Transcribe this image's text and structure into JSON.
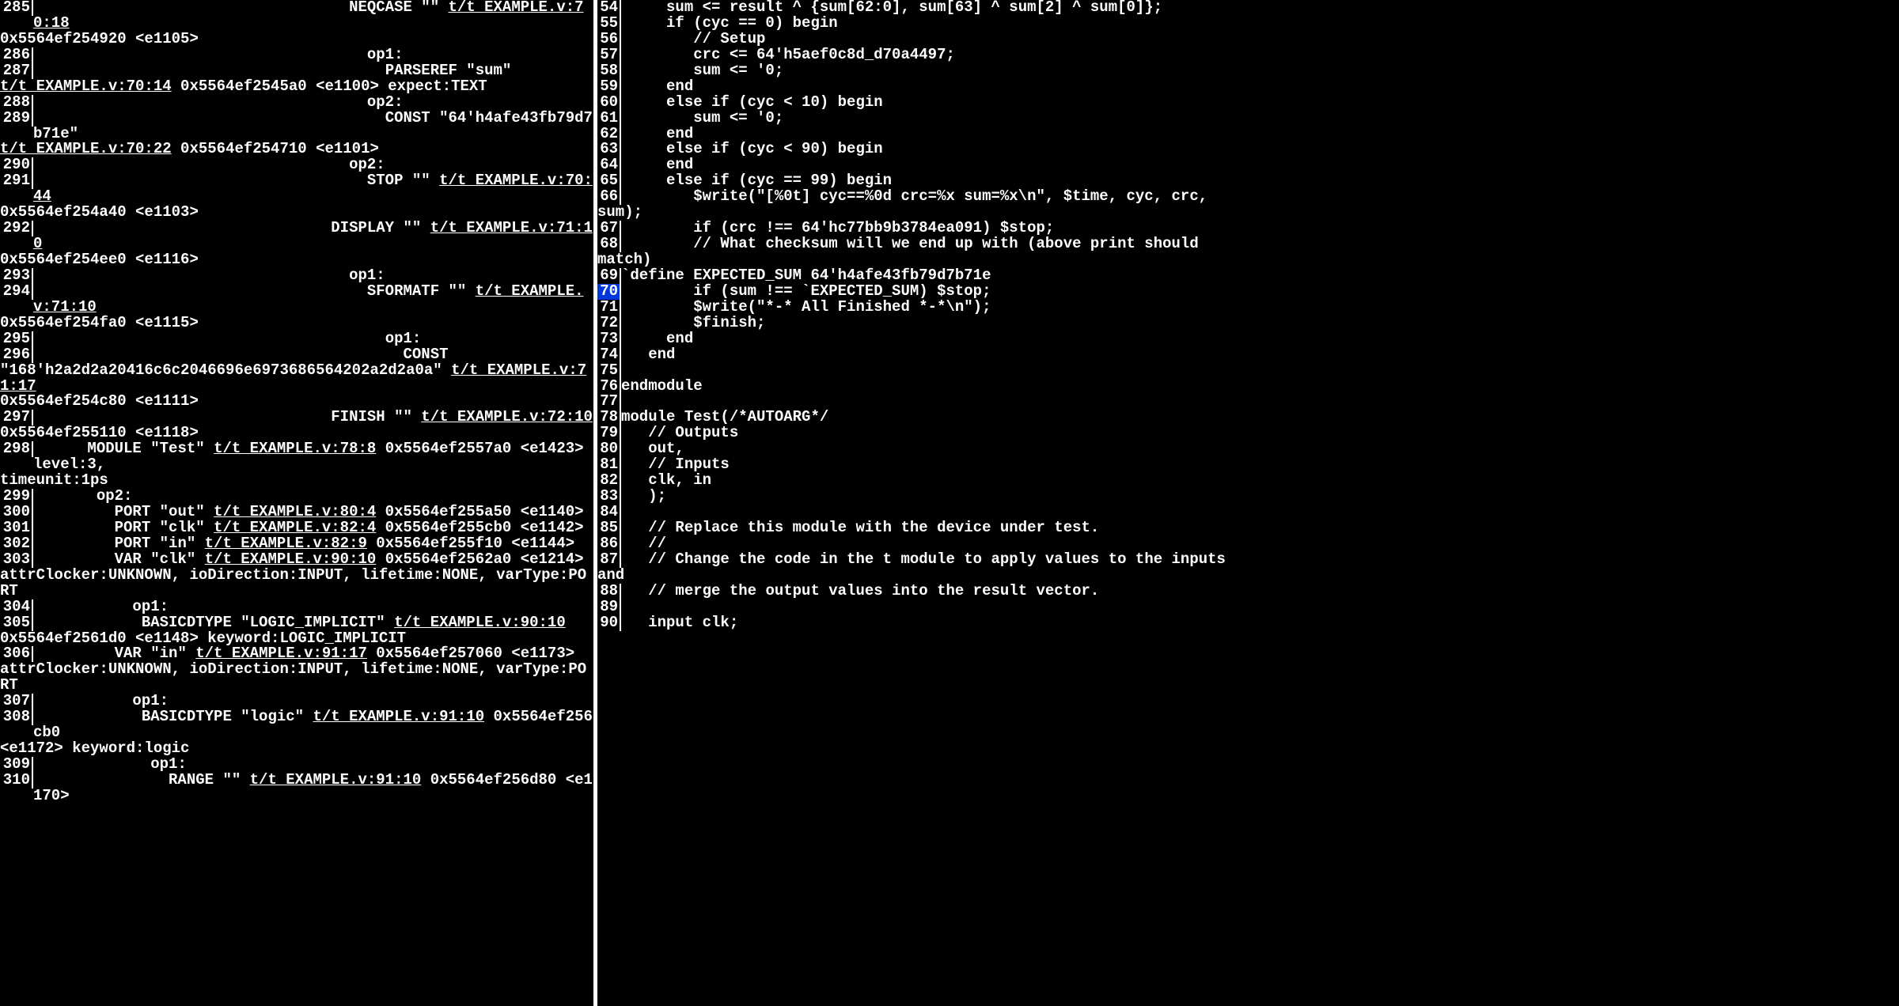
{
  "left": [
    {
      "n": "285",
      "segs": [
        {
          "t": "                                   NEQCASE \"\" "
        },
        {
          "t": "t/t_EXAMPLE.v:70:18",
          "u": true
        }
      ]
    },
    {
      "n": "",
      "segs": [
        {
          "t": "0x5564ef254920 <e1105>"
        }
      ]
    },
    {
      "n": "286",
      "segs": [
        {
          "t": "                                     op1:"
        }
      ]
    },
    {
      "n": "287",
      "segs": [
        {
          "t": "                                       PARSEREF \"sum\""
        }
      ]
    },
    {
      "n": "",
      "segs": [
        {
          "t": "t/t_EXAMPLE.v:70:14",
          "u": true
        },
        {
          "t": " 0x5564ef2545a0 <e1100> expect:TEXT"
        }
      ]
    },
    {
      "n": "288",
      "segs": [
        {
          "t": "                                     op2:"
        }
      ]
    },
    {
      "n": "289",
      "segs": [
        {
          "t": "                                       CONST \"64'h4afe43fb79d7b71e\""
        }
      ]
    },
    {
      "n": "",
      "segs": [
        {
          "t": "t/t_EXAMPLE.v:70:22",
          "u": true
        },
        {
          "t": " 0x5564ef254710 <e1101>"
        }
      ]
    },
    {
      "n": "290",
      "segs": [
        {
          "t": "                                   op2:"
        }
      ]
    },
    {
      "n": "291",
      "segs": [
        {
          "t": "                                     STOP \"\" "
        },
        {
          "t": "t/t_EXAMPLE.v:70:44",
          "u": true
        }
      ]
    },
    {
      "n": "",
      "segs": [
        {
          "t": "0x5564ef254a40 <e1103>"
        }
      ]
    },
    {
      "n": "292",
      "segs": [
        {
          "t": "                                 DISPLAY \"\" "
        },
        {
          "t": "t/t_EXAMPLE.v:71:10",
          "u": true
        }
      ]
    },
    {
      "n": "",
      "segs": [
        {
          "t": "0x5564ef254ee0 <e1116>"
        }
      ]
    },
    {
      "n": "293",
      "segs": [
        {
          "t": "                                   op1:"
        }
      ]
    },
    {
      "n": "294",
      "segs": [
        {
          "t": "                                     SFORMATF \"\" "
        },
        {
          "t": "t/t_EXAMPLE.v:71:10",
          "u": true
        }
      ]
    },
    {
      "n": "",
      "segs": [
        {
          "t": "0x5564ef254fa0 <e1115>"
        }
      ]
    },
    {
      "n": "295",
      "segs": [
        {
          "t": "                                       op1:"
        }
      ]
    },
    {
      "n": "296",
      "segs": [
        {
          "t": "                                         CONST"
        }
      ]
    },
    {
      "n": "",
      "segs": [
        {
          "t": "\"168'h2a2d2a20416c6c2046696e6973686564202a2d2a0a\" "
        },
        {
          "t": "t/t_EXAMPLE.v:71:17",
          "u": true
        }
      ]
    },
    {
      "n": "",
      "segs": [
        {
          "t": "0x5564ef254c80 <e1111>"
        }
      ]
    },
    {
      "n": "297",
      "segs": [
        {
          "t": "                                 FINISH \"\" "
        },
        {
          "t": "t/t_EXAMPLE.v:72:10",
          "u": true
        }
      ]
    },
    {
      "n": "",
      "segs": [
        {
          "t": "0x5564ef255110 <e1118>"
        }
      ]
    },
    {
      "n": "298",
      "segs": [
        {
          "t": "      MODULE \"Test\" "
        },
        {
          "t": "t/t_EXAMPLE.v:78:8",
          "u": true
        },
        {
          "t": " 0x5564ef2557a0 <e1423> level:3,"
        }
      ]
    },
    {
      "n": "",
      "segs": [
        {
          "t": "timeunit:1ps"
        }
      ]
    },
    {
      "n": "299",
      "segs": [
        {
          "t": "       op2:"
        }
      ]
    },
    {
      "n": "300",
      "segs": [
        {
          "t": "         PORT \"out\" "
        },
        {
          "t": "t/t_EXAMPLE.v:80:4",
          "u": true
        },
        {
          "t": " 0x5564ef255a50 <e1140>"
        }
      ]
    },
    {
      "n": "301",
      "segs": [
        {
          "t": "         PORT \"clk\" "
        },
        {
          "t": "t/t_EXAMPLE.v:82:4",
          "u": true
        },
        {
          "t": " 0x5564ef255cb0 <e1142>"
        }
      ]
    },
    {
      "n": "302",
      "segs": [
        {
          "t": "         PORT \"in\" "
        },
        {
          "t": "t/t_EXAMPLE.v:82:9",
          "u": true
        },
        {
          "t": " 0x5564ef255f10 <e1144>"
        }
      ]
    },
    {
      "n": "303",
      "segs": [
        {
          "t": "         VAR \"clk\" "
        },
        {
          "t": "t/t_EXAMPLE.v:90:10",
          "u": true
        },
        {
          "t": " 0x5564ef2562a0 <e1214>"
        }
      ]
    },
    {
      "n": "",
      "segs": [
        {
          "t": "attrClocker:UNKNOWN, ioDirection:INPUT, lifetime:NONE, varType:PORT"
        }
      ]
    },
    {
      "n": "304",
      "segs": [
        {
          "t": "           op1:"
        }
      ]
    },
    {
      "n": "305",
      "segs": [
        {
          "t": "            BASICDTYPE \"LOGIC_IMPLICIT\" "
        },
        {
          "t": "t/t_EXAMPLE.v:90:10",
          "u": true
        }
      ]
    },
    {
      "n": "",
      "segs": [
        {
          "t": "0x5564ef2561d0 <e1148> keyword:LOGIC_IMPLICIT"
        }
      ]
    },
    {
      "n": "306",
      "segs": [
        {
          "t": "         VAR \"in\" "
        },
        {
          "t": "t/t_EXAMPLE.v:91:17",
          "u": true
        },
        {
          "t": " 0x5564ef257060 <e1173>"
        }
      ]
    },
    {
      "n": "",
      "segs": [
        {
          "t": "attrClocker:UNKNOWN, ioDirection:INPUT, lifetime:NONE, varType:PORT"
        }
      ]
    },
    {
      "n": "307",
      "segs": [
        {
          "t": "           op1:"
        }
      ]
    },
    {
      "n": "308",
      "segs": [
        {
          "t": "            BASICDTYPE \"logic\" "
        },
        {
          "t": "t/t_EXAMPLE.v:91:10",
          "u": true
        },
        {
          "t": " 0x5564ef256cb0"
        }
      ]
    },
    {
      "n": "",
      "segs": [
        {
          "t": "<e1172> keyword:logic"
        }
      ]
    },
    {
      "n": "309",
      "segs": [
        {
          "t": "             op1:"
        }
      ]
    },
    {
      "n": "310",
      "segs": [
        {
          "t": "               RANGE \"\" "
        },
        {
          "t": "t/t_EXAMPLE.v:91:10",
          "u": true
        },
        {
          "t": " 0x5564ef256d80 <e1170>"
        }
      ]
    }
  ],
  "right": [
    {
      "n": "54",
      "t": "     sum <= result ^ {sum[62:0], sum[63] ^ sum[2] ^ sum[0]};"
    },
    {
      "n": "55",
      "t": "     if (cyc == 0) begin"
    },
    {
      "n": "56",
      "t": "        // Setup"
    },
    {
      "n": "57",
      "t": "        crc <= 64'h5aef0c8d_d70a4497;"
    },
    {
      "n": "58",
      "t": "        sum <= '0;"
    },
    {
      "n": "59",
      "t": "     end"
    },
    {
      "n": "60",
      "t": "     else if (cyc < 10) begin"
    },
    {
      "n": "61",
      "t": "        sum <= '0;"
    },
    {
      "n": "62",
      "t": "     end"
    },
    {
      "n": "63",
      "t": "     else if (cyc < 90) begin"
    },
    {
      "n": "64",
      "t": "     end"
    },
    {
      "n": "65",
      "t": "     else if (cyc == 99) begin"
    },
    {
      "n": "66",
      "t": "        $write(\"[%0t] cyc==%0d crc=%x sum=%x\\n\", $time, cyc, crc,"
    },
    {
      "n": "",
      "t": "sum);"
    },
    {
      "n": "67",
      "t": "        if (crc !== 64'hc77bb9b3784ea091) $stop;"
    },
    {
      "n": "68",
      "t": "        // What checksum will we end up with (above print should"
    },
    {
      "n": "",
      "t": "match)"
    },
    {
      "n": "69",
      "t": "`define EXPECTED_SUM 64'h4afe43fb79d7b71e"
    },
    {
      "n": "70",
      "t": "        if (sum !== `EXPECTED_SUM) $stop;",
      "hl": true
    },
    {
      "n": "71",
      "t": "        $write(\"*-* All Finished *-*\\n\");"
    },
    {
      "n": "72",
      "t": "        $finish;"
    },
    {
      "n": "73",
      "t": "     end"
    },
    {
      "n": "74",
      "t": "   end"
    },
    {
      "n": "75",
      "t": ""
    },
    {
      "n": "76",
      "t": "endmodule"
    },
    {
      "n": "77",
      "t": ""
    },
    {
      "n": "78",
      "t": "module Test(/*AUTOARG*/"
    },
    {
      "n": "79",
      "t": "   // Outputs"
    },
    {
      "n": "80",
      "t": "   out,"
    },
    {
      "n": "81",
      "t": "   // Inputs"
    },
    {
      "n": "82",
      "t": "   clk, in"
    },
    {
      "n": "83",
      "t": "   );"
    },
    {
      "n": "84",
      "t": ""
    },
    {
      "n": "85",
      "t": "   // Replace this module with the device under test."
    },
    {
      "n": "86",
      "t": "   //"
    },
    {
      "n": "87",
      "t": "   // Change the code in the t module to apply values to the inputs"
    },
    {
      "n": "",
      "t": "and"
    },
    {
      "n": "88",
      "t": "   // merge the output values into the result vector."
    },
    {
      "n": "89",
      "t": ""
    },
    {
      "n": "90",
      "t": "   input clk;"
    }
  ]
}
